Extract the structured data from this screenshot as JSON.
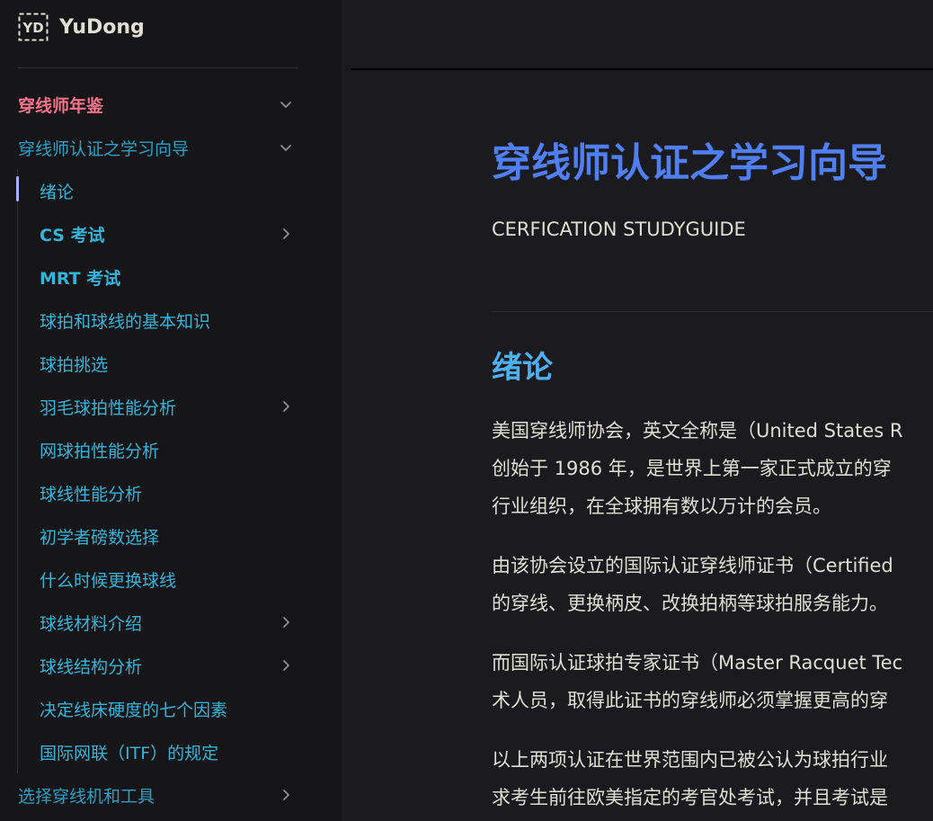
{
  "brand": {
    "name": "YuDong",
    "logo_text": "YD"
  },
  "sidebar": {
    "items": [
      {
        "label": "穿线师年鉴",
        "state": "active",
        "chevron": "down"
      },
      {
        "label": "穿线师认证之学习向导",
        "state": "open",
        "chevron": "down"
      },
      {
        "label": "绪论",
        "chevron": ""
      },
      {
        "label": "CS 考试",
        "chevron": "right"
      },
      {
        "label": "MRT 考试",
        "chevron": ""
      },
      {
        "label": "球拍和球线的基本知识",
        "chevron": ""
      },
      {
        "label": "球拍挑选",
        "chevron": ""
      },
      {
        "label": "羽毛球拍性能分析",
        "chevron": "right"
      },
      {
        "label": "网球拍性能分析",
        "chevron": ""
      },
      {
        "label": "球线性能分析",
        "chevron": ""
      },
      {
        "label": "初学者磅数选择",
        "chevron": ""
      },
      {
        "label": "什么时候更换球线",
        "chevron": ""
      },
      {
        "label": "球线材料介绍",
        "chevron": "right"
      },
      {
        "label": "球线结构分析",
        "chevron": "right"
      },
      {
        "label": "决定线床硬度的七个因素",
        "chevron": ""
      },
      {
        "label": "国际网联（ITF）的规定",
        "chevron": ""
      },
      {
        "label": "选择穿线机和工具",
        "chevron": "right"
      }
    ]
  },
  "main": {
    "title": "穿线师认证之学习向导",
    "subtitle": "CERFICATION STUDYGUIDE",
    "section_heading": "绪论",
    "paragraphs": [
      {
        "lines": [
          "美国穿线师协会，英文全称是（United States R",
          "创始于 1986 年，是世界上第一家正式成立的穿",
          "行业组织，在全球拥有数以万计的会员。"
        ]
      },
      {
        "lines": [
          "由该协会设立的国际认证穿线师证书（Certified",
          "的穿线、更换柄皮、改换拍柄等球拍服务能力。"
        ]
      },
      {
        "lines": [
          "而国际认证球拍专家证书（Master Racquet Tec",
          "术人员，取得此证书的穿线师必须掌握更高的穿"
        ]
      },
      {
        "lines": [
          "以上两项认证在世界范围内已被公认为球拍行业",
          "求考生前往欧美指定的考官处考试，并且考试是"
        ]
      }
    ]
  },
  "colors": {
    "sidebar_bg": "#161618",
    "content_bg": "#1b1b1f",
    "active_top": "#f5738a",
    "link": "#36b3d8",
    "title": "#4f7ff0",
    "heading": "#4fb0ee",
    "text": "#dfdfd6",
    "marker": "#a8b1ff"
  }
}
